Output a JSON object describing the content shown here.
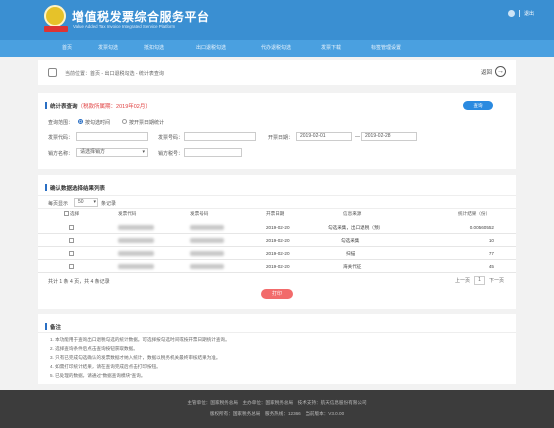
{
  "header": {
    "title": "增值税发票综合服务平台",
    "subtitle": "Value Added Tax Invoice Integrated Service Platform",
    "logout": "退出"
  },
  "nav": {
    "items": [
      "首页",
      "发票勾选",
      "抵扣勾选",
      "出口退税勾选",
      "代办退税勾选",
      "发票下载",
      "标签管理设置"
    ]
  },
  "breadcrumb": {
    "prefix": "当前位置：",
    "path": "首页 - 出口退税勾选 - 统计表查询",
    "back_label": "返回"
  },
  "query": {
    "title": "统计表查询",
    "title_note": "（税款所属期：2019年02月）",
    "search_label": "查询",
    "scope_label": "查询范围：",
    "scope_options": [
      "按勾选时间",
      "按开票日期统计"
    ],
    "scope_selected": 0,
    "invoice_code_label": "发票代码：",
    "invoice_number_label": "发票号码：",
    "issue_date_label": "开票日期：",
    "date_from": "2019-02-01",
    "date_to": "2019-02-28",
    "seller_label": "销方名称：",
    "seller_placeholder": "请选择销方",
    "seller_tax_label": "销方税号："
  },
  "results": {
    "title": "确认数据选择结果列表",
    "page_size_label": "每页显示",
    "page_size": "50",
    "page_size_suffix": "条记录",
    "columns": [
      "选择",
      "发票代码",
      "发票号码",
      "开票日期",
      "信息来源",
      "统计结果（份）"
    ],
    "rows": [
      {
        "date": "2019-02-20",
        "source": "勾选采集，出口退税（预）",
        "amount": "0.00560552"
      },
      {
        "date": "2019-02-20",
        "source": "勾选采集",
        "amount": "10"
      },
      {
        "date": "2019-02-20",
        "source": "扫描",
        "amount": "77"
      },
      {
        "date": "2019-02-20",
        "source": "海关代征",
        "amount": "45"
      }
    ],
    "summary": "共计 1 条 4 页，共 4 条记录",
    "prev": "上一页",
    "page": "1",
    "next": "下一页",
    "confirm_label": "打印"
  },
  "notes": {
    "title": "备注",
    "items": [
      "1. 本功能用于查询出口退税勾选的统计数据。可选择按勾选时间或按开票日期统计查询。",
      "2. 选择查询条件后点击查询按钮获取数据。",
      "3. 只有已完成勾选确认的发票数据才纳入统计，数据以税务机关最终审核结果为准。",
      "4. 如需打印统计结果，请在查询完成后点击打印按钮。",
      "5. 已处理的数据，请通过“数据查询模块”查询。"
    ]
  },
  "footer": {
    "line1": "主管单位：国家税务总局　主办单位：国家税务总局　技术支持：航天信息股份有限公司",
    "line2": "版权所有：国家税务总局　服务热线：12366　当前版本：V3.0.00"
  }
}
